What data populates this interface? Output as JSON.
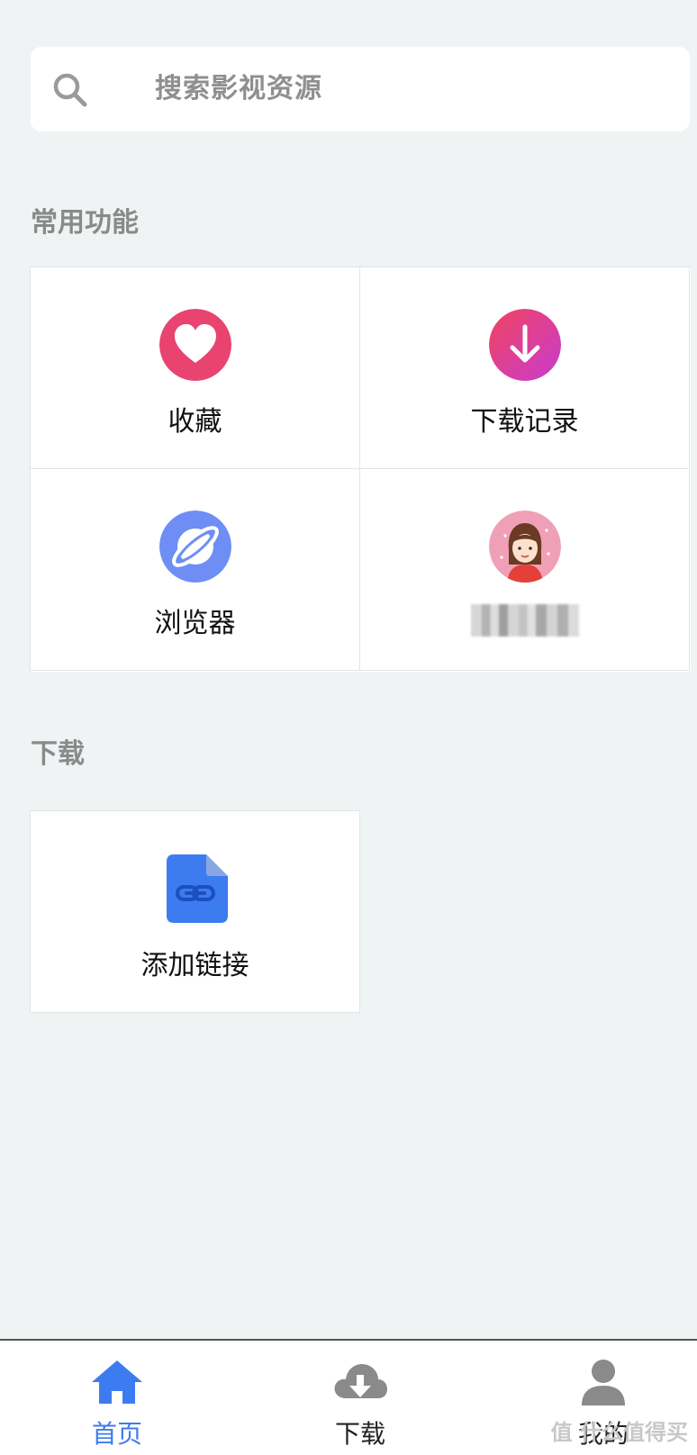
{
  "search": {
    "placeholder": "搜索影视资源",
    "icon": "search-icon"
  },
  "sections": {
    "common": {
      "title": "常用功能",
      "items": [
        {
          "label": "收藏",
          "icon": "heart-icon",
          "color": "#e94370"
        },
        {
          "label": "下载记录",
          "icon": "download-arrow-icon",
          "color": "#e2428c"
        },
        {
          "label": "浏览器",
          "icon": "planet-icon",
          "color": "#6e8ef5"
        },
        {
          "label": "",
          "icon": "avatar-girl-icon",
          "color": "#f0a0b6"
        }
      ]
    },
    "download": {
      "title": "下载",
      "items": [
        {
          "label": "添加链接",
          "icon": "link-file-icon",
          "color": "#3d7cf0"
        }
      ]
    }
  },
  "tabbar": {
    "tabs": [
      {
        "label": "首页",
        "icon": "home-icon",
        "active": true
      },
      {
        "label": "下载",
        "icon": "cloud-download-icon",
        "active": false
      },
      {
        "label": "我的",
        "icon": "user-icon",
        "active": false
      }
    ],
    "active_color": "#3d7cf0",
    "inactive_color": "#222222"
  },
  "watermark": "值 什么值得买"
}
